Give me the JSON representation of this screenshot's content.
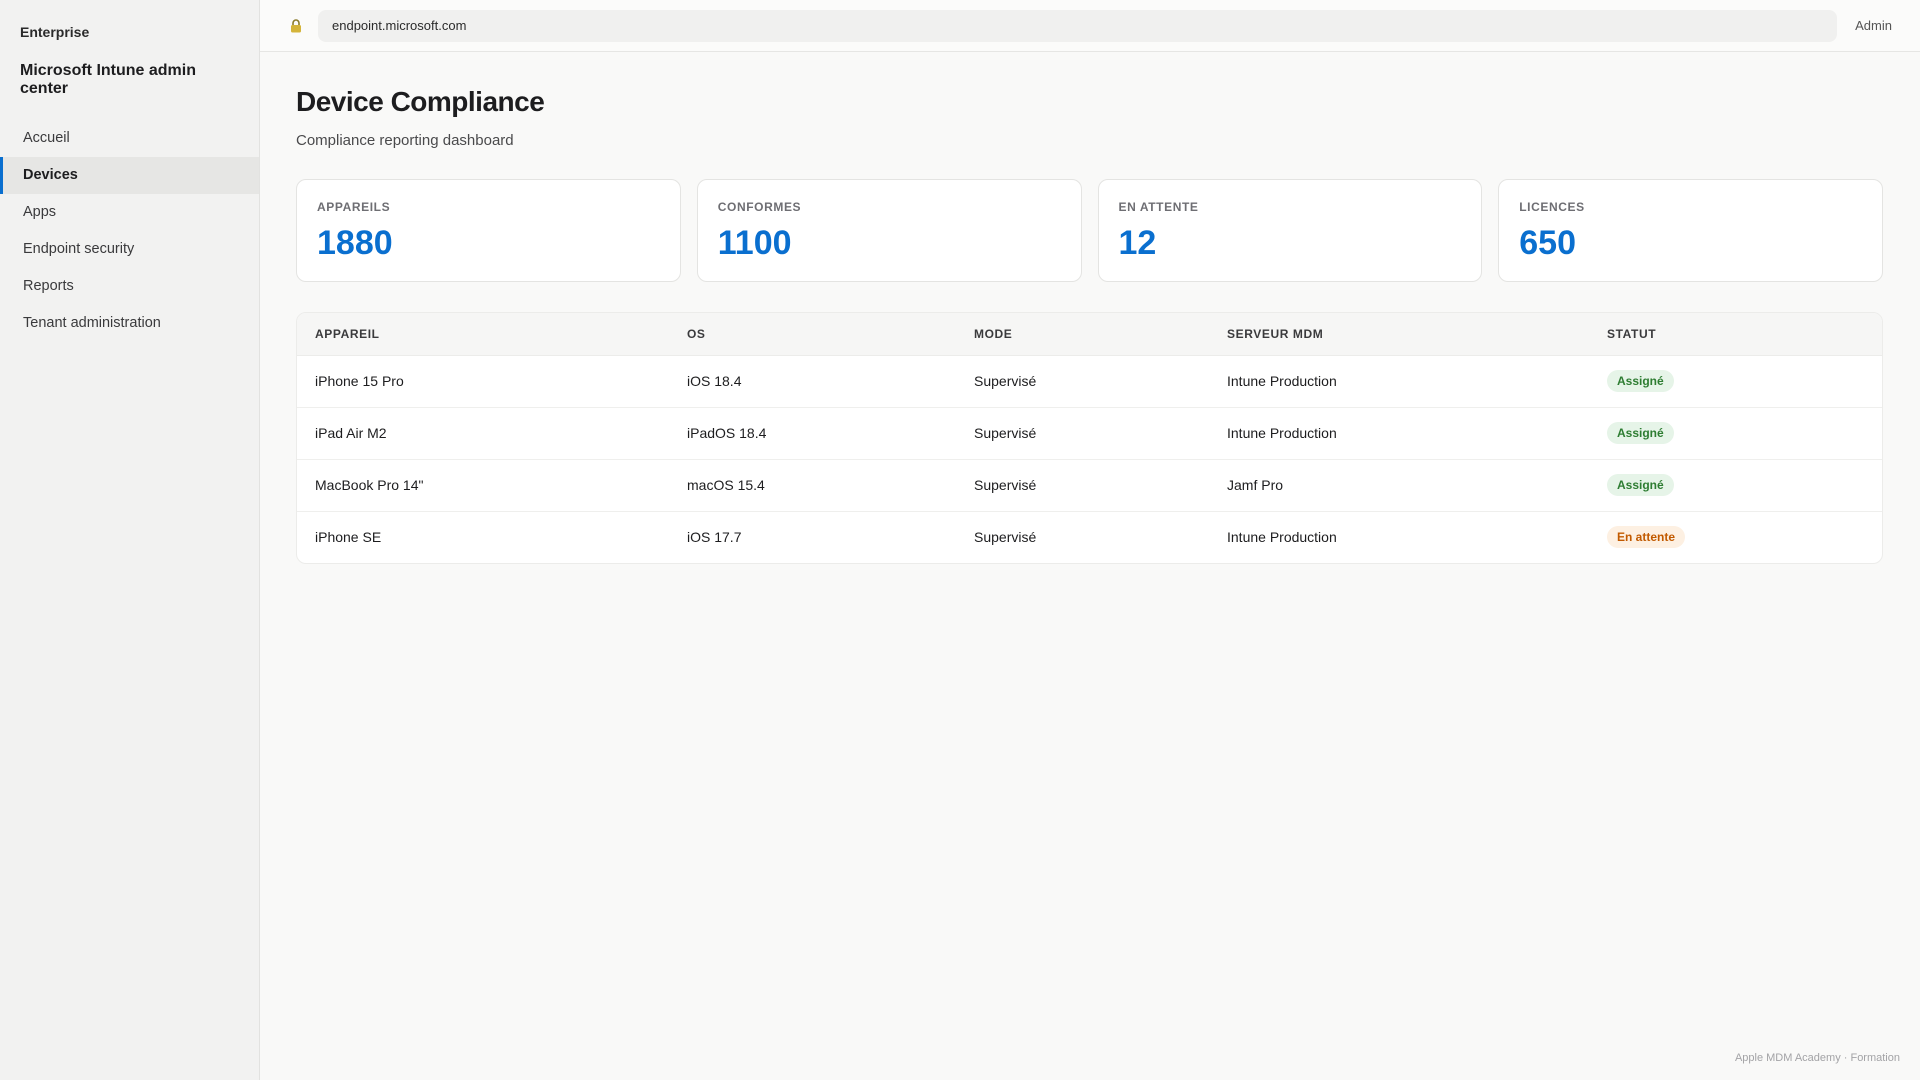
{
  "sidebar": {
    "org": "Enterprise",
    "app_title": "Microsoft Intune admin center",
    "items": [
      {
        "label": "Accueil"
      },
      {
        "label": "Devices"
      },
      {
        "label": "Apps"
      },
      {
        "label": "Endpoint security"
      },
      {
        "label": "Reports"
      },
      {
        "label": "Tenant administration"
      }
    ],
    "active_index": 1
  },
  "topbar": {
    "lock_icon": "lock-icon",
    "url": "endpoint.microsoft.com",
    "user": "Admin"
  },
  "page": {
    "title": "Device Compliance",
    "subtitle": "Compliance reporting dashboard"
  },
  "stats": [
    {
      "label": "APPAREILS",
      "value": "1880"
    },
    {
      "label": "CONFORMES",
      "value": "1100"
    },
    {
      "label": "EN ATTENTE",
      "value": "12"
    },
    {
      "label": "LICENCES",
      "value": "650"
    }
  ],
  "table": {
    "columns": [
      "APPAREIL",
      "OS",
      "MODE",
      "SERVEUR MDM",
      "STATUT"
    ],
    "rows": [
      {
        "device": "iPhone 15 Pro",
        "os": "iOS 18.4",
        "mode": "Supervisé",
        "server": "Intune Production",
        "status": "Assigné"
      },
      {
        "device": "iPad Air M2",
        "os": "iPadOS 18.4",
        "mode": "Supervisé",
        "server": "Intune Production",
        "status": "Assigné"
      },
      {
        "device": "MacBook Pro 14\"",
        "os": "macOS 15.4",
        "mode": "Supervisé",
        "server": "Jamf Pro",
        "status": "Assigné"
      },
      {
        "device": "iPhone SE",
        "os": "iOS 17.7",
        "mode": "Supervisé",
        "server": "Intune Production",
        "status": "En attente"
      }
    ]
  },
  "colors": {
    "accent": "#0a6fcf",
    "status_ok_bg": "#e6f4e8",
    "status_ok_text": "#2e7d32",
    "status_pending_bg": "#fdf0e2",
    "status_pending_text": "#c25a00"
  },
  "footer": {
    "note": "Apple MDM Academy · Formation"
  }
}
